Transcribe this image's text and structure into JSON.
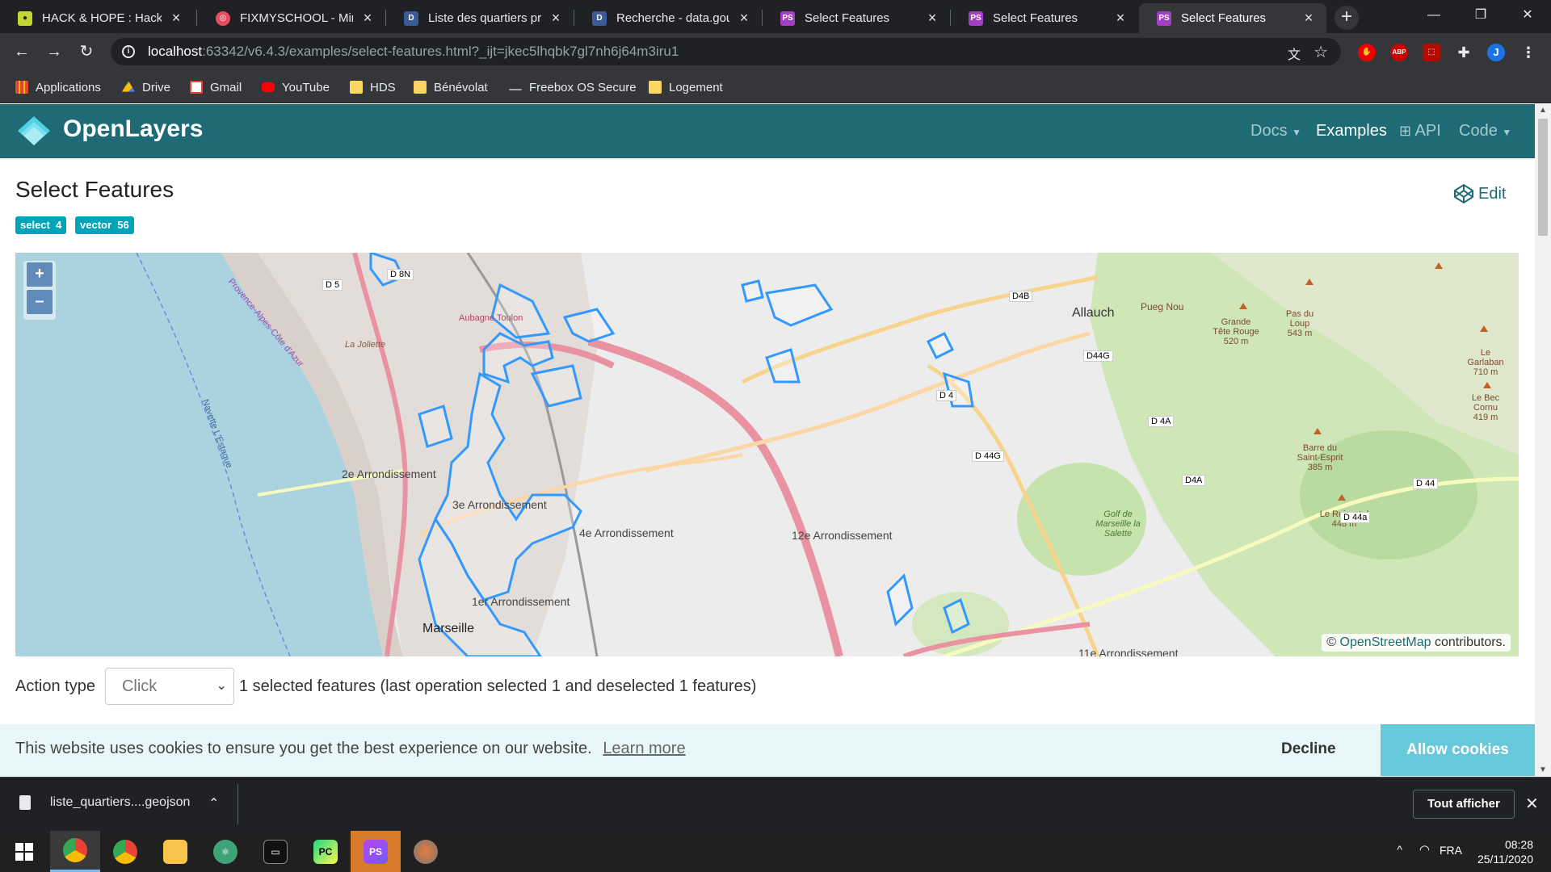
{
  "browser": {
    "tabs": [
      {
        "label": "HACK & HOPE : HackH",
        "favicon": "hackhope-icon",
        "color": "#c5d532"
      },
      {
        "label": "FIXMYSCHOOL - Mindl",
        "favicon": "mindmap-icon",
        "color": "#e84a5f"
      },
      {
        "label": "Liste des quartiers prio",
        "favicon": "datagouv-icon",
        "color": "#3d5a98"
      },
      {
        "label": "Recherche - data.gouv",
        "favicon": "datagouv-icon",
        "color": "#3d5a98"
      },
      {
        "label": "Select Features",
        "favicon": "phpstorm-icon",
        "color": "#a33fc5"
      },
      {
        "label": "Select Features",
        "favicon": "phpstorm-icon",
        "color": "#a33fc5"
      },
      {
        "label": "Select Features",
        "favicon": "phpstorm-icon",
        "color": "#a33fc5",
        "active": true
      }
    ],
    "url_host": "localhost",
    "url_path": ":63342/v6.4.3/examples/select-features.html?_ijt=jkec5lhqbk7gl7nh6j64m3iru1",
    "profile_initial": "J",
    "bookmarks": [
      {
        "label": "Applications",
        "icon": "apps-grid-icon"
      },
      {
        "label": "Drive",
        "icon": "drive-icon"
      },
      {
        "label": "Gmail",
        "icon": "gmail-icon"
      },
      {
        "label": "YouTube",
        "icon": "youtube-icon"
      },
      {
        "label": "HDS",
        "icon": "folder-icon"
      },
      {
        "label": "Bénévolat",
        "icon": "folder-icon"
      },
      {
        "label": "Freebox OS Secure",
        "icon": "freebox-icon"
      },
      {
        "label": "Logement",
        "icon": "folder-icon"
      }
    ],
    "ext_abp": "ABP"
  },
  "site": {
    "brand": "OpenLayers",
    "nav": {
      "docs": "Docs",
      "examples": "Examples",
      "api": "API",
      "code": "Code"
    },
    "accent": "#1f6b75",
    "title": "Select Features",
    "edit": "Edit",
    "tags": [
      {
        "label": "select",
        "count": "4"
      },
      {
        "label": "vector",
        "count": "56"
      }
    ]
  },
  "map": {
    "zoom_in": "+",
    "zoom_out": "–",
    "labels": {
      "allauch": "Allauch",
      "arr2": "2e Arrondissement",
      "arr3": "3e Arrondissement",
      "arr4": "4e Arrondissement",
      "arr12": "12e Arrondissement",
      "arr1": "1er Arrondissement",
      "arr11": "11e Arrondissement",
      "marseille": "Marseille",
      "pueg": "Pueg Nou",
      "grande_tete": "Grande Tête Rouge",
      "grande_tete_alt": "520 m",
      "pas_du_loup": "Pas du Loup",
      "pas_du_loup_alt": "543 m",
      "garlaban": "Le Garlaban",
      "garlaban_alt": "710 m",
      "bec_cornu": "Le Bec Cornu",
      "bec_cornu_alt": "419 m",
      "barre": "Barre du Saint-Esprit",
      "barre_alt": "385 m",
      "ruissatel": "Le Ruissatel",
      "ruissatel_alt": "448 m",
      "golf": "Golf de Marseille la Salette",
      "d4b": "D4B",
      "d44g": "D44G",
      "d44g2": "D 44G",
      "d4": "D 4",
      "d4a": "D 4A",
      "d4a2": "D4A",
      "d44": "D 44",
      "d44a": "D 44a",
      "d5": "D 5",
      "d8n": "D 8N",
      "aubagne": "Aubagne Toulon",
      "joliette": "La Joliette",
      "navette": "Navette L'Estaque",
      "provence": "Provence-Alpes-Côte d'Azur"
    },
    "attribution_prefix": "©",
    "attribution_link": "OpenStreetMap",
    "attribution_suffix": "contributors."
  },
  "controls": {
    "action_label": "Action type",
    "action_value": "Click",
    "status": "1 selected features (last operation selected 1 and deselected 1 features)"
  },
  "cookie": {
    "message": "This website uses cookies to ensure you get the best experience on our website.",
    "learn_more": "Learn more",
    "decline": "Decline",
    "allow": "Allow cookies"
  },
  "download": {
    "filename": "liste_quartiers....geojson",
    "show_all": "Tout afficher"
  },
  "taskbar": {
    "lang": "FRA",
    "time": "08:28",
    "date": "25/11/2020"
  }
}
